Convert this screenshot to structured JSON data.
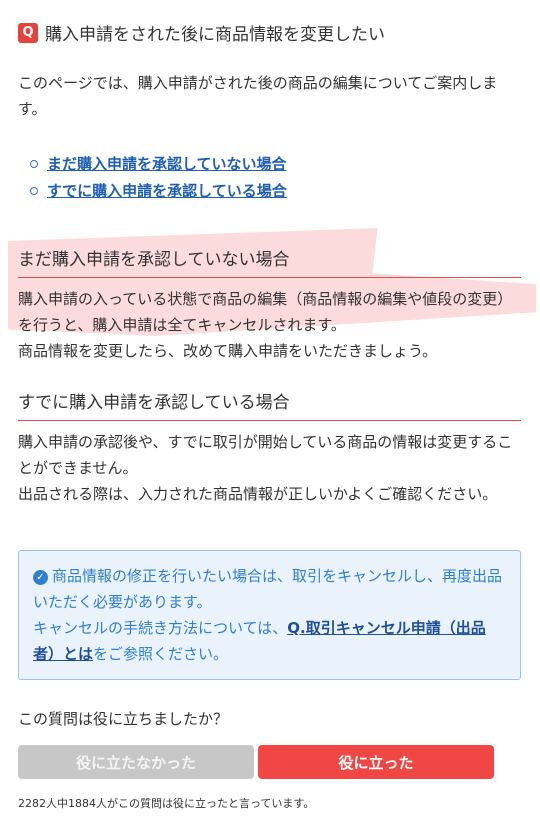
{
  "question": {
    "badge": "Q",
    "title": "購入申請をされた後に商品情報を変更したい"
  },
  "intro": "このページでは、購入申請がされた後の商品の編集についてご案内します。",
  "toc": [
    {
      "label": "まだ購入申請を承認していない場合"
    },
    {
      "label": "すでに購入申請を承認している場合"
    }
  ],
  "sections": [
    {
      "heading": "まだ購入申請を承認していない場合",
      "body": "購入申請の入っている状態で商品の編集（商品情報の編集や値段の変更）を行うと、購入申請は全てキャンセルされます。\n商品情報を変更したら、改めて購入申請をいただきましょう。"
    },
    {
      "heading": "すでに購入申請を承認している場合",
      "body": "購入申請の承認後や、すでに取引が開始している商品の情報は変更することができません。\n出品される際は、入力された商品情報が正しいかよくご確認ください。"
    }
  ],
  "note": {
    "line1": "商品情報の修正を行いたい場合は、取引をキャンセルし、再度出品いただく必要があります。",
    "line2_before": "キャンセルの手続き方法については、",
    "link": "Q.取引キャンセル申請（出品者）とは",
    "line2_after": "をご参照ください。"
  },
  "feedback": {
    "question": "この質問は役に立ちましたか？",
    "no_label": "役に立たなかった",
    "yes_label": "役に立った",
    "stats": "2282人中1884人がこの質問は役に立ったと言っています。"
  },
  "colors": {
    "accent_red": "#e8423c",
    "link_blue": "#1f5fb3",
    "note_bg": "#eaf3fc",
    "note_text": "#2f7fd0"
  },
  "icons": {
    "note_icon": "check-circle-icon",
    "toc_bullet": "circle-bullet-icon"
  }
}
